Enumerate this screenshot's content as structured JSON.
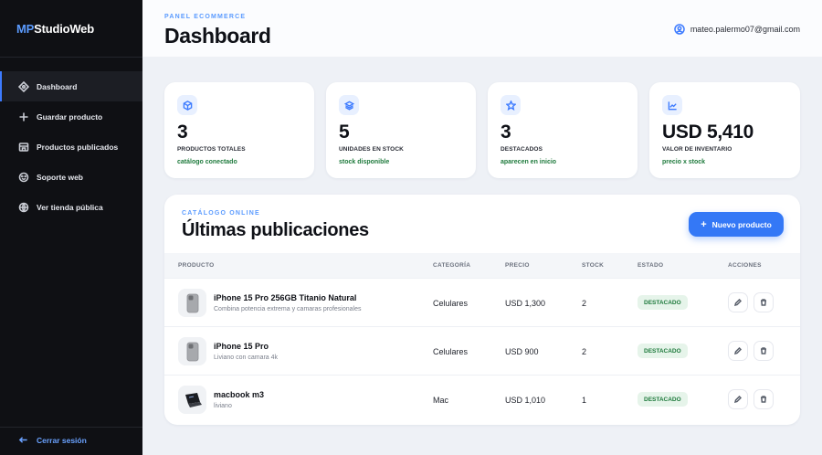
{
  "brand": {
    "prefix": "MP",
    "name": "StudioWeb"
  },
  "sidebar": {
    "items": [
      {
        "label": "Dashboard",
        "icon": "dashboard-icon"
      },
      {
        "label": "Guardar producto",
        "icon": "plus-icon"
      },
      {
        "label": "Productos publicados",
        "icon": "store-icon"
      },
      {
        "label": "Soporte web",
        "icon": "support-icon"
      },
      {
        "label": "Ver tienda pública",
        "icon": "globe-icon"
      }
    ],
    "logout_label": "Cerrar sesión"
  },
  "header": {
    "eyebrow": "PANEL ECOMMERCE",
    "title": "Dashboard",
    "user_email": "mateo.palermo07@gmail.com"
  },
  "stats": [
    {
      "value": "3",
      "label": "PRODUCTOS TOTALES",
      "sub": "catálogo conectado",
      "icon": "box-icon"
    },
    {
      "value": "5",
      "label": "UNIDADES EN STOCK",
      "sub": "stock disponible",
      "icon": "layers-icon"
    },
    {
      "value": "3",
      "label": "DESTACADOS",
      "sub": "aparecen en inicio",
      "icon": "star-icon"
    },
    {
      "value": "USD 5,410",
      "label": "VALOR DE INVENTARIO",
      "sub": "precio x stock",
      "icon": "trend-icon"
    }
  ],
  "catalog": {
    "eyebrow": "CATÁLOGO ONLINE",
    "title": "Últimas publicaciones",
    "new_button": "Nuevo producto",
    "columns": [
      "PRODUCTO",
      "CATEGORÍA",
      "PRECIO",
      "STOCK",
      "ESTADO",
      "ACCIONES"
    ],
    "rows": [
      {
        "name": "iPhone 15 Pro 256GB Titanio Natural",
        "desc": "Combina potencia extrema y camaras profesionales",
        "category": "Celulares",
        "price": "USD 1,300",
        "stock": "2",
        "status": "DESTACADO"
      },
      {
        "name": "iPhone 15 Pro",
        "desc": "Liviano con camara 4k",
        "category": "Celulares",
        "price": "USD 900",
        "stock": "2",
        "status": "DESTACADO"
      },
      {
        "name": "macbook m3",
        "desc": "liviano",
        "category": "Mac",
        "price": "USD 1,010",
        "stock": "1",
        "status": "DESTACADO"
      }
    ]
  },
  "colors": {
    "accent": "#3478f6",
    "sidebar_bg": "#0f1014",
    "success": "#1e7a3c"
  }
}
